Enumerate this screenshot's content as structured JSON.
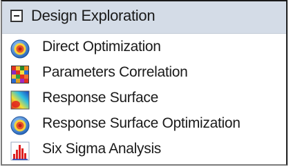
{
  "group": {
    "title": "Design Exploration",
    "expanded": true,
    "header_color": "#d4dce7"
  },
  "items": [
    {
      "label": "Direct Optimization",
      "icon": "target-icon"
    },
    {
      "label": "Parameters Correlation",
      "icon": "correlation-matrix-icon"
    },
    {
      "label": "Response Surface",
      "icon": "response-surface-icon"
    },
    {
      "label": "Response Surface Optimization",
      "icon": "target-icon"
    },
    {
      "label": "Six Sigma Analysis",
      "icon": "histogram-icon"
    }
  ]
}
